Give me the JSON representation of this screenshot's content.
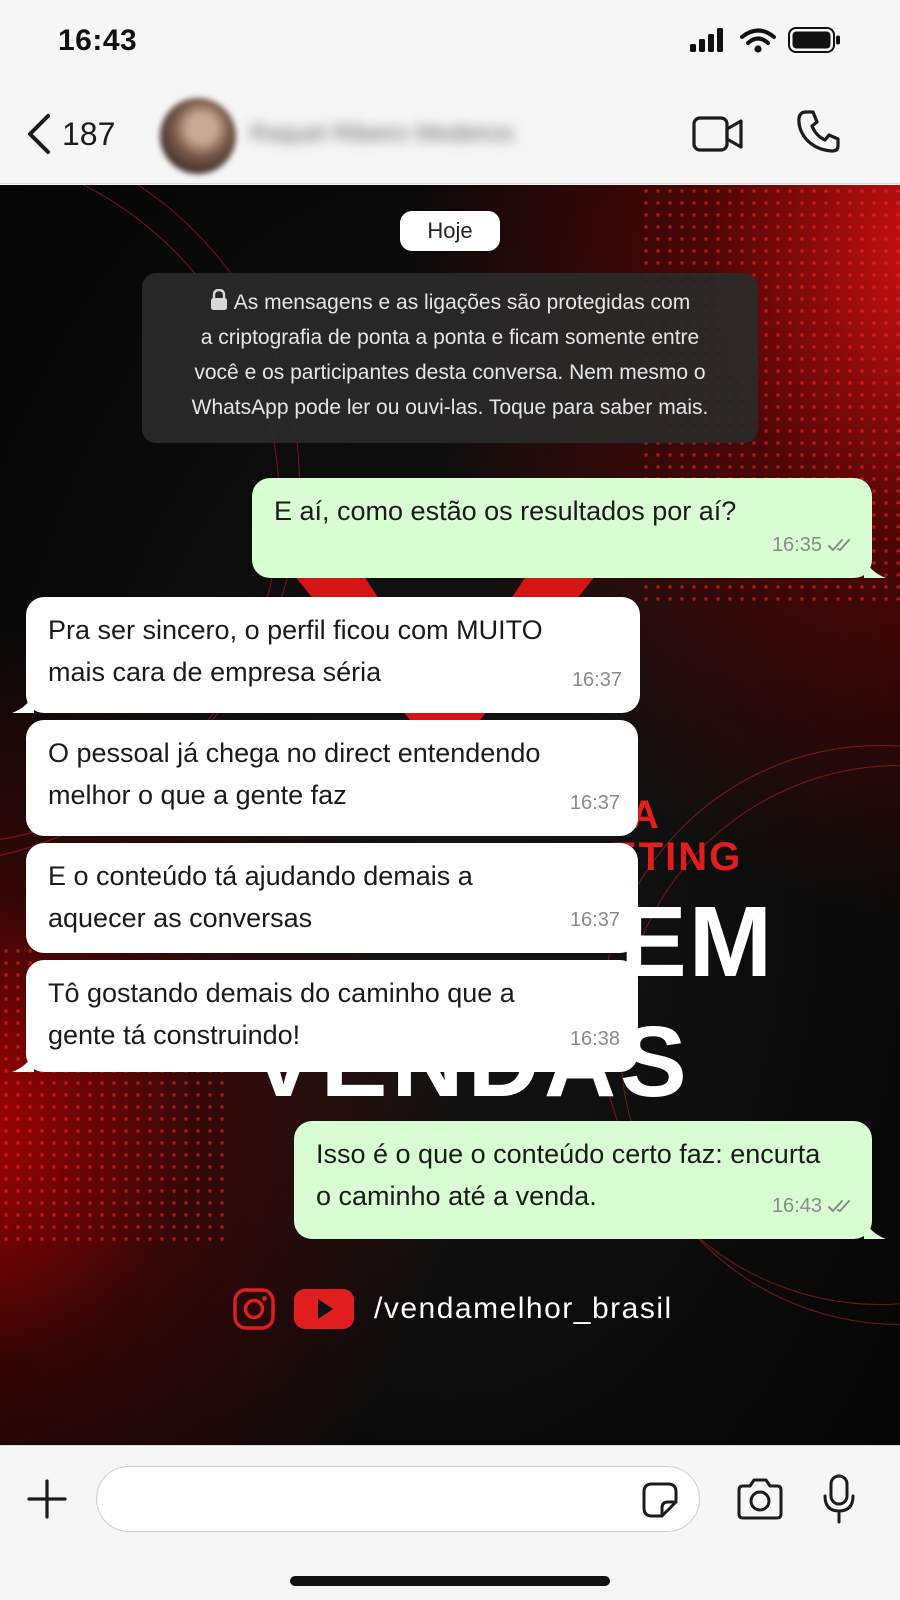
{
  "status_bar": {
    "time": "16:43",
    "icons": [
      "signal-icon",
      "wifi-icon",
      "battery-icon"
    ]
  },
  "header": {
    "back_count": "187",
    "contact_name": "Raquel Ribeiro Medeiros",
    "icons": [
      "chevron-left-icon",
      "video-call-icon",
      "phone-icon"
    ]
  },
  "chat": {
    "date_chip": "Hoje",
    "encryption_notice": {
      "line1": "As mensagens e as ligações são protegidas com",
      "line2": "a criptografia de ponta a ponta e ficam somente entre",
      "line3": "você e os participantes desta conversa. Nem mesmo o",
      "line4": "WhatsApp pode ler ou ouvi-las. Toque para saber mais."
    },
    "messages": [
      {
        "direction": "outgoing",
        "lines": [
          "E aí, como estão os resultados por aí?"
        ],
        "time": "16:35",
        "status": "read"
      },
      {
        "direction": "incoming",
        "lines": [
          "Pra ser sincero, o perfil ficou com MUITO",
          "mais cara de empresa séria"
        ],
        "time": "16:37"
      },
      {
        "direction": "incoming",
        "lines": [
          "O pessoal já chega no direct entendendo",
          "melhor o que a gente faz"
        ],
        "time": "16:37"
      },
      {
        "direction": "incoming",
        "lines": [
          "E o conteúdo tá ajudando demais a",
          "aquecer as conversas"
        ],
        "time": "16:37"
      },
      {
        "direction": "incoming",
        "lines": [
          "Tô gostando demais do caminho que a",
          "gente tá construindo!"
        ],
        "time": "16:38"
      },
      {
        "direction": "outgoing",
        "lines": [
          "Isso é o que o conteúdo certo faz: encurta",
          "o caminho até a venda."
        ],
        "time": "16:43",
        "status": "read"
      }
    ],
    "wallpaper": {
      "text_a": "A",
      "text_eting": "ETING",
      "text_em": "EM",
      "text_vendas": "VENDAS",
      "social_handle": "/vendamelhor_brasil",
      "social_icons": [
        "instagram-icon",
        "youtube-icon"
      ],
      "accent_color": "#e01e1e"
    }
  },
  "composer": {
    "icons": [
      "plus-icon",
      "sticker-icon",
      "camera-icon",
      "microphone-icon"
    ]
  },
  "colors": {
    "outgoing_bubble": "#d9fdd3",
    "incoming_bubble": "#ffffff",
    "wallpaper_red": "#e01e1e"
  }
}
